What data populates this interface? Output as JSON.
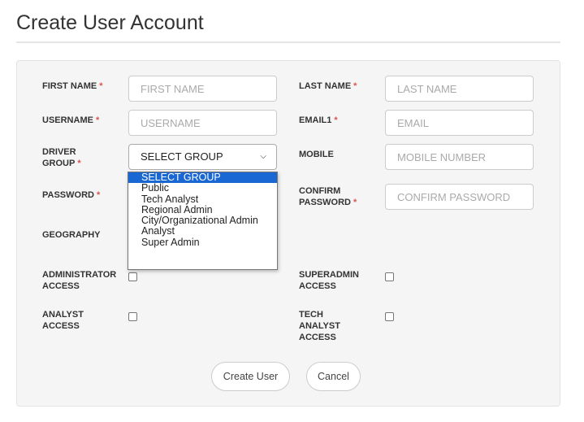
{
  "page": {
    "title": "Create User Account"
  },
  "form": {
    "first_name": {
      "label": "FIRST NAME",
      "placeholder": "FIRST NAME",
      "required": "*"
    },
    "last_name": {
      "label": "LAST NAME",
      "placeholder": "LAST NAME",
      "required": "*"
    },
    "username": {
      "label": "USERNAME",
      "placeholder": "USERNAME",
      "required": "*"
    },
    "email": {
      "label": "EMAIL1",
      "placeholder": "EMAIL",
      "required": "*"
    },
    "driver_group": {
      "label_line1": "DRIVER",
      "label_line2": "GROUP",
      "required": "*",
      "selected": "SELECT GROUP"
    },
    "mobile": {
      "label": "MOBILE",
      "placeholder": "MOBILE NUMBER"
    },
    "password": {
      "label": "PASSWORD",
      "required": "*"
    },
    "confirm_password": {
      "label_line1": "CONFIRM",
      "label_line2": "PASSWORD",
      "required": "*",
      "placeholder": "CONFIRM PASSWORD"
    },
    "geography": {
      "label": "GEOGRAPHY"
    },
    "administrator_access": {
      "label_line1": "ADMINISTRATOR",
      "label_line2": "ACCESS"
    },
    "superadmin_access": {
      "label_line1": "SUPERADMIN",
      "label_line2": "ACCESS"
    },
    "analyst_access": {
      "label_line1": "ANALYST",
      "label_line2": "ACCESS"
    },
    "tech_analyst_access": {
      "label_line1": "TECH",
      "label_line2": "ANALYST",
      "label_line3": "ACCESS"
    }
  },
  "dropdown": {
    "options": [
      "SELECT GROUP",
      "Public",
      "Tech Analyst",
      "Regional Admin",
      "City/Organizational Admin",
      "Analyst",
      "Super Admin"
    ],
    "highlighted_index": 0
  },
  "buttons": {
    "create": "Create User",
    "cancel": "Cancel"
  },
  "colors": {
    "required": "#d9534f",
    "highlight": "#1967d2"
  }
}
